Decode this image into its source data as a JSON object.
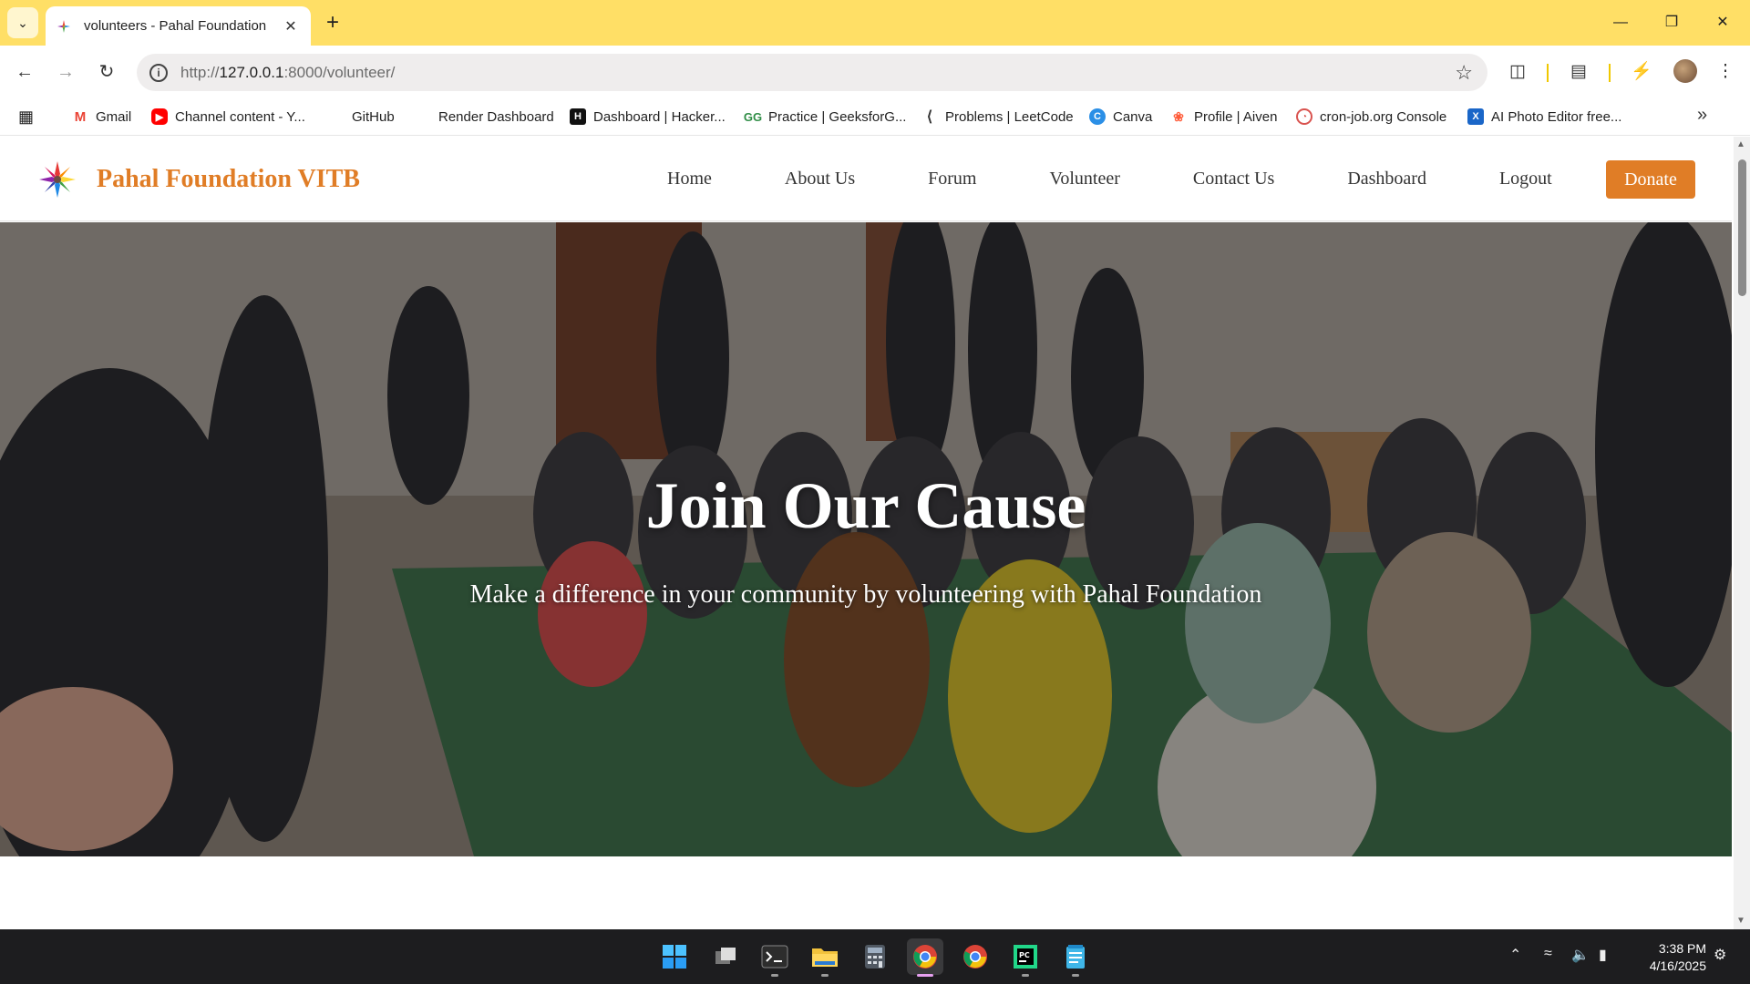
{
  "browser": {
    "tab_title": "volunteers - Pahal Foundation",
    "url_prefix": "http://",
    "url_host": "127.0.0.1",
    "url_rest": ":8000/volunteer/",
    "theme_color": "#ffdf66"
  },
  "bookmarks": [
    {
      "label": "Gmail",
      "icon": "gmail-icon"
    },
    {
      "label": "Channel content - Y...",
      "icon": "youtube-icon"
    },
    {
      "label": "GitHub",
      "icon": "github-icon"
    },
    {
      "label": "Render Dashboard",
      "icon": "render-icon"
    },
    {
      "label": "Dashboard | Hacker...",
      "icon": "hackerrank-icon"
    },
    {
      "label": "Practice | GeeksforG...",
      "icon": "geeksforgeeks-icon"
    },
    {
      "label": "Problems | LeetCode",
      "icon": "leetcode-icon"
    },
    {
      "label": "Canva",
      "icon": "canva-icon"
    },
    {
      "label": "Profile | Aiven",
      "icon": "aiven-icon"
    },
    {
      "label": "cron-job.org Console",
      "icon": "cronjob-icon"
    },
    {
      "label": "AI Photo Editor free...",
      "icon": "photo-editor-icon"
    }
  ],
  "site": {
    "brand": "Pahal Foundation VITB",
    "brand_color": "#e07d26",
    "nav": [
      "Home",
      "About Us",
      "Forum",
      "Volunteer",
      "Contact Us",
      "Dashboard",
      "Logout"
    ],
    "donate_label": "Donate",
    "hero_title": "Join Our Cause",
    "hero_subtitle": "Make a difference in your community by volunteering with Pahal Foundation"
  },
  "taskbar": {
    "apps": [
      "start-icon",
      "task-view-icon",
      "terminal-icon",
      "file-explorer-icon",
      "calculator-icon",
      "chrome-icon",
      "chrome-profile-icon",
      "pycharm-icon",
      "notepad-icon"
    ],
    "time": "3:38 PM",
    "date": "4/16/2025"
  }
}
